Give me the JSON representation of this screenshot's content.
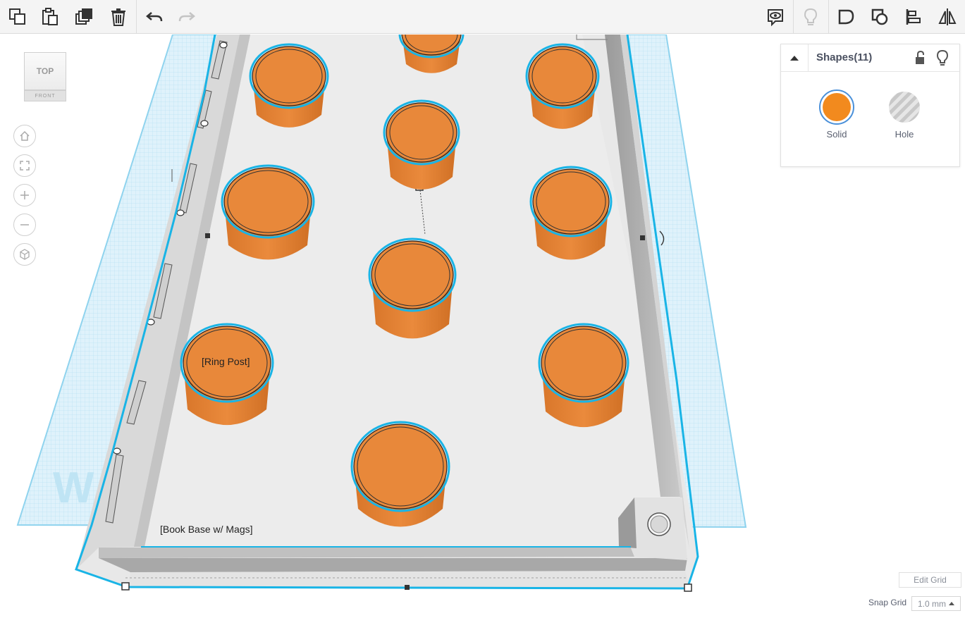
{
  "toolbar": {
    "left_tools": [
      "copy-icon",
      "paste-icon",
      "duplicate-icon",
      "delete-icon",
      "undo-icon",
      "redo-icon"
    ],
    "right_tools": [
      "show-all-icon",
      "toggle-visibility-icon",
      "group-icon",
      "ungroup-icon",
      "align-icon",
      "mirror-icon"
    ]
  },
  "viewcube": {
    "top_label": "TOP",
    "front_label": "FRONT"
  },
  "nav_controls": [
    "home-icon",
    "fit-icon",
    "zoom-in-icon",
    "zoom-out-icon",
    "perspective-icon"
  ],
  "panel": {
    "title": "Shapes(11)",
    "solid_label": "Solid",
    "hole_label": "Hole",
    "solid_color": "#F28A1E"
  },
  "scene": {
    "ring_post_label": "[Ring Post]",
    "book_base_label": "[Book Base w/ Mags]",
    "watermark": "W",
    "accent": "#19B4E6",
    "cylinder_color": "#E8883A"
  },
  "grid": {
    "edit_label": "Edit Grid",
    "snap_label": "Snap Grid",
    "snap_value": "1.0 mm"
  }
}
